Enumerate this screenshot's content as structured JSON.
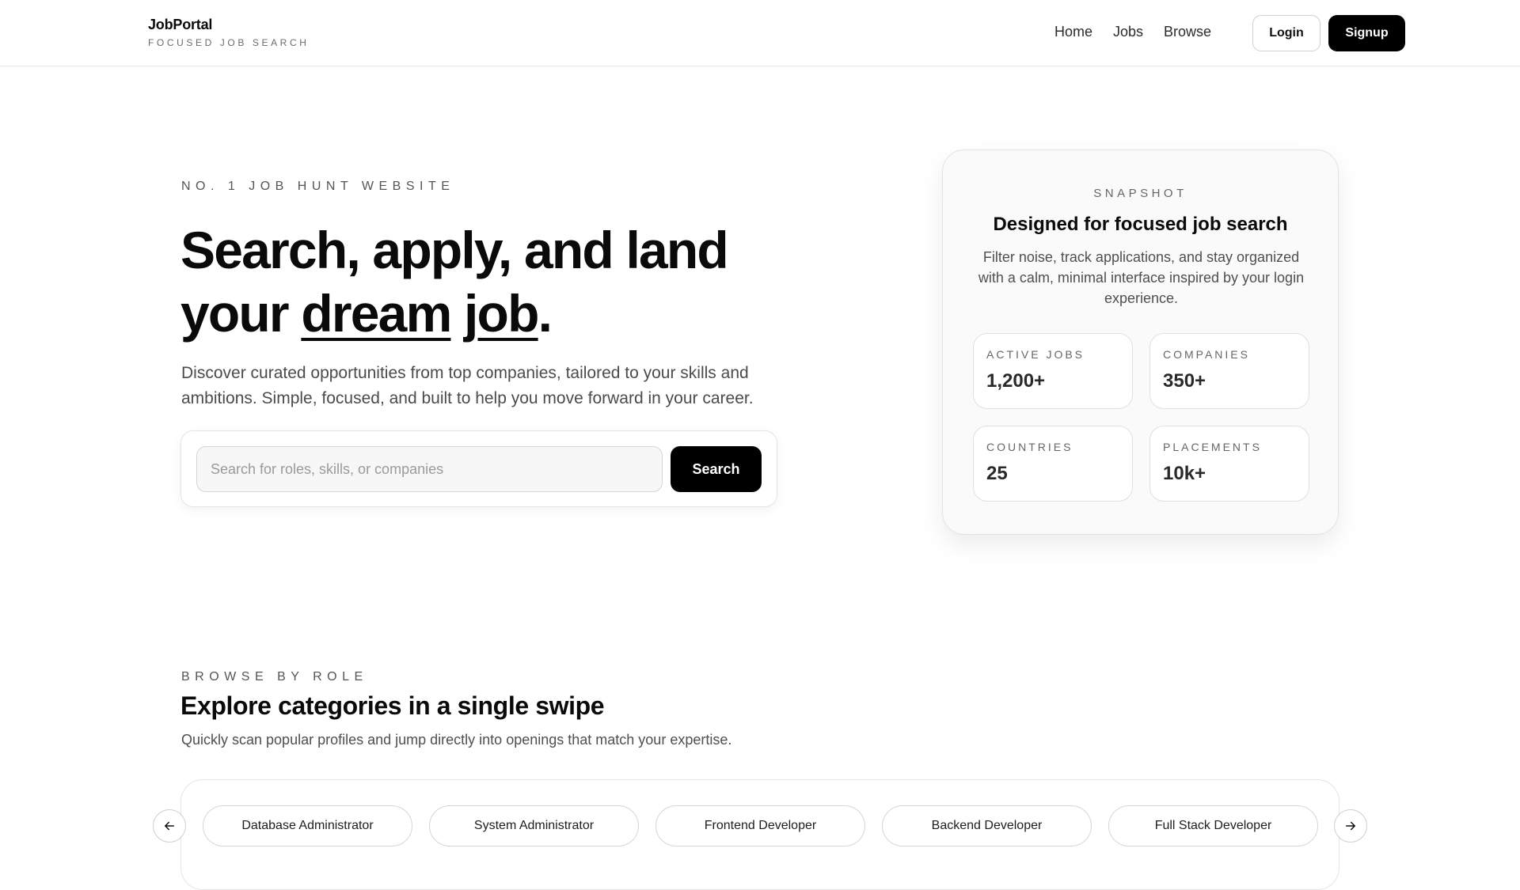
{
  "header": {
    "brand_name": "JobPortal",
    "brand_tagline": "FOCUSED JOB SEARCH",
    "nav": [
      "Home",
      "Jobs",
      "Browse"
    ],
    "login_label": "Login",
    "signup_label": "Signup"
  },
  "hero": {
    "eyebrow": "NO. 1 JOB HUNT WEBSITE",
    "title_line1": "Search, apply, and land",
    "title_your": "your ",
    "title_dream": "dream",
    "title_job": "job",
    "title_period": ".",
    "subtitle": "Discover curated opportunities from top companies, tailored to your skills and ambitions. Simple, focused, and built to help you move forward in your career.",
    "search_placeholder": "Search for roles, skills, or companies",
    "search_button": "Search"
  },
  "snapshot": {
    "eyebrow": "SNAPSHOT",
    "title": "Designed for focused job search",
    "description": "Filter noise, track applications, and stay organized with a calm, minimal interface inspired by your login experience.",
    "stats": [
      {
        "label": "ACTIVE JOBS",
        "value": "1,200+"
      },
      {
        "label": "COMPANIES",
        "value": "350+"
      },
      {
        "label": "COUNTRIES",
        "value": "25"
      },
      {
        "label": "PLACEMENTS",
        "value": "10k+"
      }
    ]
  },
  "browse": {
    "eyebrow": "BROWSE BY ROLE",
    "title": "Explore categories in a single swipe",
    "subtitle": "Quickly scan popular profiles and jump directly into openings that match your expertise.",
    "categories": [
      "Database Administrator",
      "System Administrator",
      "Frontend Developer",
      "Backend Developer",
      "Full Stack Developer"
    ],
    "prev_icon": "arrow-left-icon",
    "next_icon": "arrow-right-icon"
  },
  "colors": {
    "accent": "#000000",
    "text": "#0a0a0a",
    "muted": "#4f4f4f",
    "border": "#e4e4e4"
  }
}
